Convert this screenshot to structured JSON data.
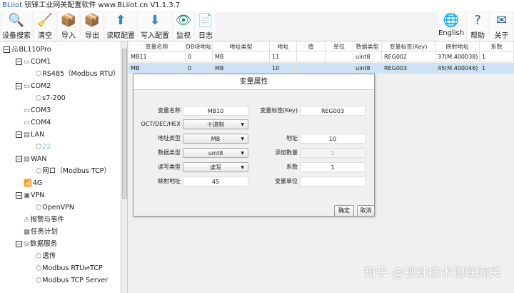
{
  "title": {
    "brand": "BLiiot",
    "text": "钡铼工业网关配置软件 www.BLiiot.cn V1.1.3.7"
  },
  "toolbar": [
    {
      "label": "设备搜索",
      "icon": "🔍"
    },
    {
      "label": "清空",
      "icon": "🧹"
    },
    {
      "label": "导入",
      "icon": "📦"
    },
    {
      "label": "导出",
      "icon": "📦"
    },
    {
      "label": "读取配置",
      "icon": "⬆"
    },
    {
      "label": "写入配置",
      "icon": "⬇"
    },
    {
      "label": "监视",
      "icon": "👁"
    },
    {
      "label": "日志",
      "icon": "📄"
    }
  ],
  "toolbar_right": [
    {
      "label": "English",
      "icon": "🌐"
    },
    {
      "label": "帮助",
      "icon": "?"
    },
    {
      "label": "关于",
      "icon": "✉"
    }
  ],
  "tree": [
    {
      "label": "BL110Pro",
      "level": 0,
      "tog": "−",
      "icon": "品"
    },
    {
      "label": "COM1",
      "level": 1,
      "tog": "−",
      "icon": "▭"
    },
    {
      "label": "RS485（Modbus RTU）",
      "level": 2,
      "icon": "⬡"
    },
    {
      "label": "COM2",
      "level": 1,
      "tog": "−",
      "icon": "▭"
    },
    {
      "label": "s7-200",
      "level": 2,
      "icon": "⬡"
    },
    {
      "label": "COM3",
      "level": 1,
      "icon": "▭"
    },
    {
      "label": "COM4",
      "level": 1,
      "icon": "▭"
    },
    {
      "label": "LAN",
      "level": 1,
      "tog": "−",
      "icon": "▤"
    },
    {
      "label": "22",
      "level": 2,
      "icon": "⬡",
      "dim": true
    },
    {
      "label": "WAN",
      "level": 1,
      "tog": "−",
      "icon": "▤"
    },
    {
      "label": "网口（Modbus TCP）",
      "level": 2,
      "icon": "⬡"
    },
    {
      "label": "4G",
      "level": 1,
      "icon": "📶"
    },
    {
      "label": "VPN",
      "level": 1,
      "tog": "−",
      "icon": "▣"
    },
    {
      "label": "OpenVPN",
      "level": 2,
      "icon": "⬡"
    },
    {
      "label": "报警与事件",
      "level": 1,
      "icon": "⚠"
    },
    {
      "label": "任务计划",
      "level": 1,
      "icon": "▦"
    },
    {
      "label": "数据服务",
      "level": 1,
      "tog": "−",
      "icon": "⛁"
    },
    {
      "label": "透传",
      "level": 2,
      "icon": "⬡"
    },
    {
      "label": "Modbus RTU⇌TCP",
      "level": 2,
      "icon": "⬡"
    },
    {
      "label": "Modbus TCP Server",
      "level": 2,
      "icon": "⬡"
    }
  ],
  "table": {
    "headers": [
      "变量名称",
      "DB块地址",
      "地址类型",
      "地址",
      "值",
      "单位",
      "数据类型",
      "变量标签(Key)",
      "映射地址",
      "系数"
    ],
    "rows": [
      [
        "MB11",
        "0",
        "MB",
        "11",
        "",
        "",
        "uint8",
        "REG002",
        "37(M.400038)",
        "1"
      ],
      [
        "MB",
        "0",
        "MB",
        "10",
        "",
        "",
        "uint8",
        "REG003",
        "45(M.400046)",
        "1"
      ]
    ]
  },
  "dialog": {
    "title": "变量属性",
    "name_label": "变量名称",
    "name": "MB10",
    "key_label": "变量标签(Key)",
    "key": "REG003",
    "base_label": "OCT/DEC/HEX",
    "base": "十进制",
    "addrtype_label": "地址类型",
    "addrtype": "MB",
    "addr_label": "地址",
    "addr": "10",
    "dtype_label": "数据类型",
    "dtype": "uint8",
    "count_label": "添加数量",
    "count": "1",
    "rw_label": "读写类型",
    "rw": "读写",
    "coef_label": "系数",
    "coef": "1",
    "map_label": "映射地址",
    "map": "45",
    "unit_label": "变量单位",
    "unit": "",
    "ok": "确定",
    "cancel": "取消"
  },
  "watermark": "知乎 @钡铼技术物联网关"
}
